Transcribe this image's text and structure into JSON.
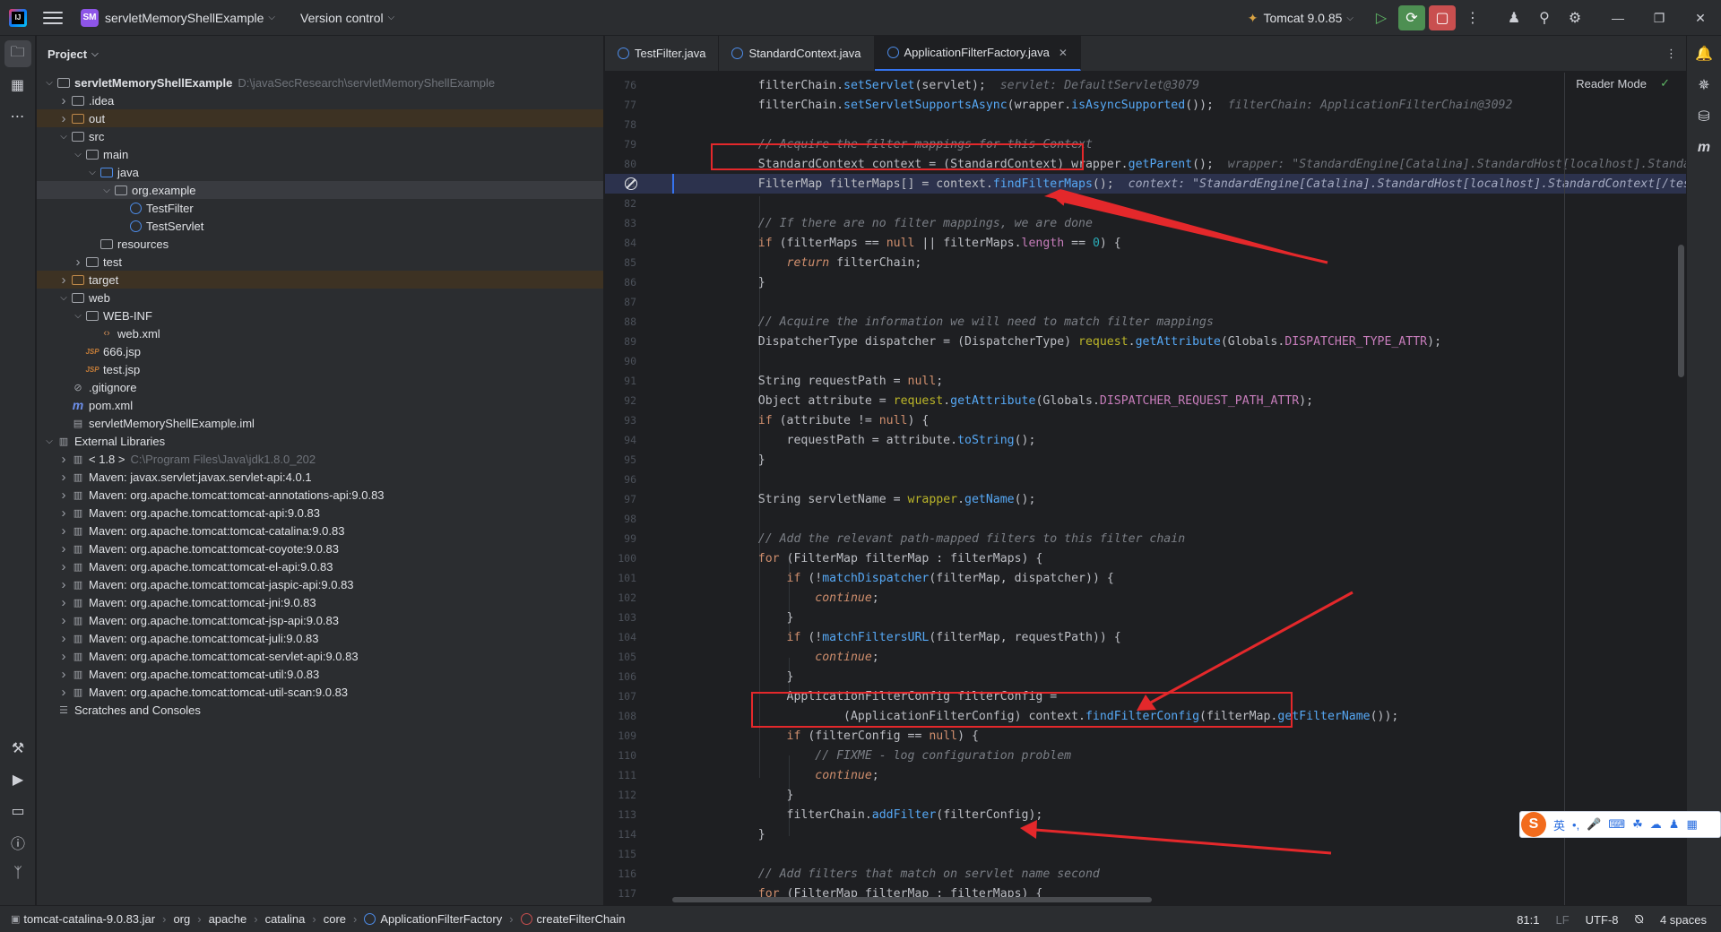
{
  "titlebar": {
    "project_badge": "SM",
    "project_name": "servletMemoryShellExample",
    "version_control": "Version control",
    "run_config": "Tomcat 9.0.85"
  },
  "project_panel": {
    "title": "Project",
    "rows": [
      {
        "depth": 0,
        "arrow": "down",
        "icon": "folder",
        "label": "servletMemoryShellExample",
        "path": "D:\\javaSecResearch\\servletMemoryShellExample",
        "bold": true
      },
      {
        "depth": 1,
        "arrow": "right",
        "icon": "folder",
        "label": ".idea"
      },
      {
        "depth": 1,
        "arrow": "right",
        "icon": "folder-orange",
        "label": "out",
        "hl": true
      },
      {
        "depth": 1,
        "arrow": "down",
        "icon": "folder",
        "label": "src"
      },
      {
        "depth": 2,
        "arrow": "down",
        "icon": "folder",
        "label": "main"
      },
      {
        "depth": 3,
        "arrow": "down",
        "icon": "folder-blue",
        "label": "java"
      },
      {
        "depth": 4,
        "arrow": "down",
        "icon": "folder",
        "label": "org.example",
        "sel": true
      },
      {
        "depth": 5,
        "arrow": "none",
        "icon": "class",
        "label": "TestFilter"
      },
      {
        "depth": 5,
        "arrow": "none",
        "icon": "class",
        "label": "TestServlet"
      },
      {
        "depth": 3,
        "arrow": "none",
        "icon": "folder",
        "label": "resources"
      },
      {
        "depth": 2,
        "arrow": "right",
        "icon": "folder",
        "label": "test"
      },
      {
        "depth": 1,
        "arrow": "right",
        "icon": "folder-orange",
        "label": "target",
        "hl": true
      },
      {
        "depth": 1,
        "arrow": "down",
        "icon": "folder",
        "label": "web"
      },
      {
        "depth": 2,
        "arrow": "down",
        "icon": "folder",
        "label": "WEB-INF"
      },
      {
        "depth": 3,
        "arrow": "none",
        "icon": "xml",
        "label": "web.xml"
      },
      {
        "depth": 2,
        "arrow": "none",
        "icon": "jsp",
        "label": "666.jsp"
      },
      {
        "depth": 2,
        "arrow": "none",
        "icon": "jsp",
        "label": "test.jsp"
      },
      {
        "depth": 1,
        "arrow": "none",
        "icon": "ignore",
        "label": ".gitignore"
      },
      {
        "depth": 1,
        "arrow": "none",
        "icon": "maven",
        "label": "pom.xml"
      },
      {
        "depth": 1,
        "arrow": "none",
        "icon": "iml",
        "label": "servletMemoryShellExample.iml"
      },
      {
        "depth": 0,
        "arrow": "down",
        "icon": "lib",
        "label": "External Libraries"
      },
      {
        "depth": 1,
        "arrow": "right",
        "icon": "lib",
        "label": "< 1.8 >",
        "path": "C:\\Program Files\\Java\\jdk1.8.0_202"
      },
      {
        "depth": 1,
        "arrow": "right",
        "icon": "lib",
        "label": "Maven: javax.servlet:javax.servlet-api:4.0.1"
      },
      {
        "depth": 1,
        "arrow": "right",
        "icon": "lib",
        "label": "Maven: org.apache.tomcat:tomcat-annotations-api:9.0.83"
      },
      {
        "depth": 1,
        "arrow": "right",
        "icon": "lib",
        "label": "Maven: org.apache.tomcat:tomcat-api:9.0.83"
      },
      {
        "depth": 1,
        "arrow": "right",
        "icon": "lib",
        "label": "Maven: org.apache.tomcat:tomcat-catalina:9.0.83"
      },
      {
        "depth": 1,
        "arrow": "right",
        "icon": "lib",
        "label": "Maven: org.apache.tomcat:tomcat-coyote:9.0.83"
      },
      {
        "depth": 1,
        "arrow": "right",
        "icon": "lib",
        "label": "Maven: org.apache.tomcat:tomcat-el-api:9.0.83"
      },
      {
        "depth": 1,
        "arrow": "right",
        "icon": "lib",
        "label": "Maven: org.apache.tomcat:tomcat-jaspic-api:9.0.83"
      },
      {
        "depth": 1,
        "arrow": "right",
        "icon": "lib",
        "label": "Maven: org.apache.tomcat:tomcat-jni:9.0.83"
      },
      {
        "depth": 1,
        "arrow": "right",
        "icon": "lib",
        "label": "Maven: org.apache.tomcat:tomcat-jsp-api:9.0.83"
      },
      {
        "depth": 1,
        "arrow": "right",
        "icon": "lib",
        "label": "Maven: org.apache.tomcat:tomcat-juli:9.0.83"
      },
      {
        "depth": 1,
        "arrow": "right",
        "icon": "lib",
        "label": "Maven: org.apache.tomcat:tomcat-servlet-api:9.0.83"
      },
      {
        "depth": 1,
        "arrow": "right",
        "icon": "lib",
        "label": "Maven: org.apache.tomcat:tomcat-util:9.0.83"
      },
      {
        "depth": 1,
        "arrow": "right",
        "icon": "lib",
        "label": "Maven: org.apache.tomcat:tomcat-util-scan:9.0.83"
      },
      {
        "depth": 0,
        "arrow": "none",
        "icon": "scratch",
        "label": "Scratches and Consoles"
      }
    ]
  },
  "tabs": [
    {
      "label": "TestFilter.java",
      "active": false
    },
    {
      "label": "StandardContext.java",
      "active": false
    },
    {
      "label": "ApplicationFilterFactory.java",
      "active": true
    }
  ],
  "editor": {
    "reader_mode": "Reader Mode",
    "lines": [
      {
        "n": "76",
        "segs": [
          [
            "",
            "    filterChain."
          ],
          [
            "fn",
            "setServlet"
          ],
          [
            "",
            "(servlet);  "
          ],
          [
            "hint",
            "servlet: DefaultServlet@3079"
          ]
        ]
      },
      {
        "n": "77",
        "segs": [
          [
            "",
            "    filterChain."
          ],
          [
            "fn",
            "setServletSupportsAsync"
          ],
          [
            "",
            "(wrapper."
          ],
          [
            "fn",
            "isAsyncSupported"
          ],
          [
            "",
            "());  "
          ],
          [
            "hint",
            "filterChain: ApplicationFilterChain@3092"
          ]
        ]
      },
      {
        "n": "78",
        "segs": []
      },
      {
        "n": "79",
        "segs": [
          [
            "cm",
            "    // Acquire the filter mappings for this Context"
          ]
        ]
      },
      {
        "n": "80",
        "segs": [
          [
            "",
            "    StandardContext context = (StandardContext) wrapper."
          ],
          [
            "fn",
            "getParent"
          ],
          [
            "",
            "();  "
          ],
          [
            "hint",
            "wrapper: \"StandardEngine[Catalina].StandardHost[localhost].Standarc"
          ]
        ]
      },
      {
        "n": "81",
        "exec": true,
        "segs": [
          [
            "",
            "    FilterMap filterMaps[] = context."
          ],
          [
            "fn",
            "findFilterMaps"
          ],
          [
            "",
            "();  "
          ],
          [
            "hint-ctx",
            "context: \"StandardEngine[Catalina].StandardHost[localhost].StandardContext[/test]"
          ]
        ]
      },
      {
        "n": "82",
        "segs": []
      },
      {
        "n": "83",
        "segs": [
          [
            "cm",
            "    // If there are no filter mappings, we are done"
          ]
        ]
      },
      {
        "n": "84",
        "segs": [
          [
            "kw",
            "    if"
          ],
          [
            "",
            " (filterMaps == "
          ],
          [
            "kw",
            "null"
          ],
          [
            "",
            " || filterMaps."
          ],
          [
            "cst",
            "length"
          ],
          [
            "",
            " == "
          ],
          [
            "num",
            "0"
          ],
          [
            "",
            ") {"
          ]
        ]
      },
      {
        "n": "85",
        "segs": [
          [
            "kwi",
            "        return"
          ],
          [
            "",
            " filterChain;"
          ]
        ]
      },
      {
        "n": "86",
        "segs": [
          [
            "",
            "    }"
          ]
        ]
      },
      {
        "n": "87",
        "segs": []
      },
      {
        "n": "88",
        "segs": [
          [
            "cm",
            "    // Acquire the information we will need to match filter mappings"
          ]
        ]
      },
      {
        "n": "89",
        "segs": [
          [
            "",
            "    DispatcherType dispatcher = (DispatcherType) "
          ],
          [
            "param",
            "request"
          ],
          [
            "",
            "."
          ],
          [
            "fn",
            "getAttribute"
          ],
          [
            "",
            "(Globals."
          ],
          [
            "cst",
            "DISPATCHER_TYPE_ATTR"
          ],
          [
            "",
            ");"
          ]
        ]
      },
      {
        "n": "90",
        "segs": []
      },
      {
        "n": "91",
        "segs": [
          [
            "",
            "    String requestPath = "
          ],
          [
            "kw",
            "null"
          ],
          [
            "",
            ";"
          ]
        ]
      },
      {
        "n": "92",
        "segs": [
          [
            "",
            "    Object attribute = "
          ],
          [
            "param",
            "request"
          ],
          [
            "",
            "."
          ],
          [
            "fn",
            "getAttribute"
          ],
          [
            "",
            "(Globals."
          ],
          [
            "cst",
            "DISPATCHER_REQUEST_PATH_ATTR"
          ],
          [
            "",
            ");"
          ]
        ]
      },
      {
        "n": "93",
        "segs": [
          [
            "kw",
            "    if"
          ],
          [
            "",
            " (attribute != "
          ],
          [
            "kw",
            "null"
          ],
          [
            "",
            ") {"
          ]
        ]
      },
      {
        "n": "94",
        "segs": [
          [
            "",
            "        requestPath = attribute."
          ],
          [
            "fn",
            "toString"
          ],
          [
            "",
            "();"
          ]
        ]
      },
      {
        "n": "95",
        "segs": [
          [
            "",
            "    }"
          ]
        ]
      },
      {
        "n": "96",
        "segs": []
      },
      {
        "n": "97",
        "segs": [
          [
            "",
            "    String servletName = "
          ],
          [
            "param",
            "wrapper"
          ],
          [
            "",
            "."
          ],
          [
            "fn",
            "getName"
          ],
          [
            "",
            "();"
          ]
        ]
      },
      {
        "n": "98",
        "segs": []
      },
      {
        "n": "99",
        "segs": [
          [
            "cm",
            "    // Add the relevant path-mapped filters to this filter chain"
          ]
        ]
      },
      {
        "n": "100",
        "segs": [
          [
            "kw",
            "    for"
          ],
          [
            "",
            " (FilterMap filterMap : filterMaps) {"
          ]
        ]
      },
      {
        "n": "101",
        "segs": [
          [
            "kw",
            "        if"
          ],
          [
            "",
            " (!"
          ],
          [
            "fn",
            "matchDispatcher"
          ],
          [
            "",
            "(filterMap, dispatcher)) {"
          ]
        ]
      },
      {
        "n": "102",
        "segs": [
          [
            "kwi",
            "            continue"
          ],
          [
            "",
            ";"
          ]
        ]
      },
      {
        "n": "103",
        "segs": [
          [
            "",
            "        }"
          ]
        ]
      },
      {
        "n": "104",
        "segs": [
          [
            "kw",
            "        if"
          ],
          [
            "",
            " (!"
          ],
          [
            "fn",
            "matchFiltersURL"
          ],
          [
            "",
            "(filterMap, requestPath)) {"
          ]
        ]
      },
      {
        "n": "105",
        "segs": [
          [
            "kwi",
            "            continue"
          ],
          [
            "",
            ";"
          ]
        ]
      },
      {
        "n": "106",
        "segs": [
          [
            "",
            "        }"
          ]
        ]
      },
      {
        "n": "107",
        "segs": [
          [
            "",
            "        ApplicationFilterConfig filterConfig ="
          ]
        ]
      },
      {
        "n": "108",
        "segs": [
          [
            "",
            "                (ApplicationFilterConfig) context."
          ],
          [
            "fn",
            "findFilterConfig"
          ],
          [
            "",
            "(filterMap."
          ],
          [
            "fn",
            "getFilterName"
          ],
          [
            "",
            "());"
          ]
        ]
      },
      {
        "n": "109",
        "segs": [
          [
            "kw",
            "        if"
          ],
          [
            "",
            " (filterConfig == "
          ],
          [
            "kw",
            "null"
          ],
          [
            "",
            ") {"
          ]
        ]
      },
      {
        "n": "110",
        "segs": [
          [
            "cm",
            "            // FIXME - log configuration problem"
          ]
        ]
      },
      {
        "n": "111",
        "segs": [
          [
            "kwi",
            "            continue"
          ],
          [
            "",
            ";"
          ]
        ]
      },
      {
        "n": "112",
        "segs": [
          [
            "",
            "        }"
          ]
        ]
      },
      {
        "n": "113",
        "segs": [
          [
            "",
            "        filterChain."
          ],
          [
            "fn",
            "addFilter"
          ],
          [
            "",
            "(filterConfig);"
          ]
        ]
      },
      {
        "n": "114",
        "segs": [
          [
            "",
            "    }"
          ]
        ]
      },
      {
        "n": "115",
        "segs": []
      },
      {
        "n": "116",
        "segs": [
          [
            "cm",
            "    // Add filters that match on servlet name second"
          ]
        ]
      },
      {
        "n": "117",
        "segs": [
          [
            "kw",
            "    for"
          ],
          [
            "",
            " (FilterMap filterMap : filterMaps) {"
          ]
        ]
      }
    ]
  },
  "ime": {
    "logo": "S",
    "lang": "英"
  },
  "statusbar": {
    "breadcrumbs": [
      "tomcat-catalina-9.0.83.jar",
      "org",
      "apache",
      "catalina",
      "core",
      "ApplicationFilterFactory",
      "createFilterChain"
    ],
    "position": "81:1",
    "line_sep": "LF",
    "encoding": "UTF-8",
    "indent": "4 spaces"
  }
}
